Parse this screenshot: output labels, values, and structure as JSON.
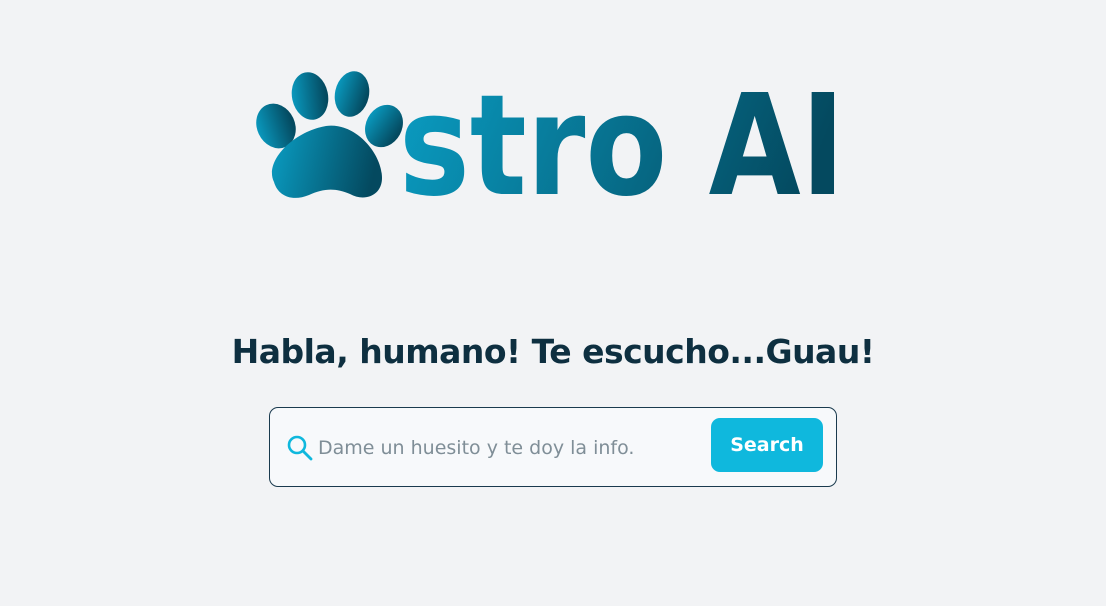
{
  "logo": {
    "text": "stro AI",
    "icon": "paw-icon",
    "gradient_start": "#0a9ec4",
    "gradient_end": "#04495f"
  },
  "heading": "Habla, humano! Te escucho...Guau!",
  "search": {
    "placeholder": "Dame un huesito y te doy la info.",
    "value": "",
    "button_label": "Search",
    "icon": "search-icon",
    "accent": "#0fb8dd",
    "border": "#1a3a4e"
  }
}
